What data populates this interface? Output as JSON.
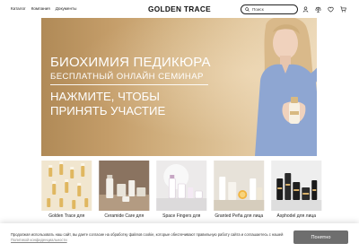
{
  "header": {
    "nav": [
      "Каталог",
      "Компания",
      "Документы"
    ],
    "logo": "GOLDEN TRACE",
    "search_placeholder": "Поиск",
    "icons": [
      "user-icon",
      "scale-icon",
      "heart-icon",
      "cart-icon"
    ]
  },
  "banner": {
    "title": "БИОХИМИЯ ПЕДИКЮРА",
    "subtitle": "БЕСПЛАТНЫЙ ОНЛАЙН СЕМИНАР",
    "cta_line1": "НАЖМИТЕ, ЧТОБЫ",
    "cta_line2": "ПРИНЯТЬ УЧАСТИЕ"
  },
  "products": [
    {
      "label": "Golden Trace для"
    },
    {
      "label": "Ceramide Care для"
    },
    {
      "label": "Space Fingers для"
    },
    {
      "label": "Granted Peña для лица"
    },
    {
      "label": "Asphodel для лица"
    }
  ],
  "cookie": {
    "text": "Продолжая использовать наш сайт, вы даете согласие на обработку файлов cookie, которые обеспечивают правильную работу сайта и соглашаетесь с нашей",
    "link": "Политикой конфиденциальности",
    "button": "Понятно"
  },
  "colors": {
    "banner_gold": "#c49d69",
    "cookie_button": "#6e6e6e"
  }
}
